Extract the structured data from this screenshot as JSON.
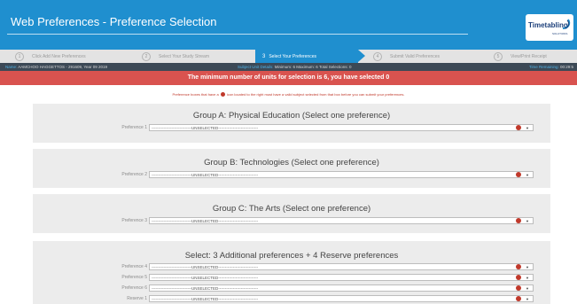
{
  "header": {
    "title": "Web Preferences - Preference Selection",
    "logo_text": "Timetabling",
    "logo_sub": "SOLUTIONS"
  },
  "steps": [
    {
      "num": "1",
      "label": "Click Add New Preferences",
      "active": false
    },
    {
      "num": "2",
      "label": "Select Your Study Stream",
      "active": false
    },
    {
      "num": "3",
      "label": "Select Your Preferences",
      "active": true
    },
    {
      "num": "4",
      "label": "Submit Valid Preferences",
      "active": false
    },
    {
      "num": "5",
      "label": "View/Print Receipt",
      "active": false
    }
  ],
  "infobar": {
    "name_key": "Name:",
    "name_value": "AAMCHOO HAGGETTOS - 291609, Year 09 2019",
    "details_key": "Subject Unit Details:",
    "details_value": "Minimum: 6 Maximum: 6 Total Selections: 0",
    "time_key": "Time Remaining:",
    "time_value": "00:29:5"
  },
  "alert": "The minimum number of units for selection is 6, you have selected 0",
  "note": {
    "before": "Preference boxes that have a",
    "after": "icon located to the right must have a valid subject selected from that box before you can submit your preferences."
  },
  "unselected_text": "------------------------------UNSELECTED------------------------------",
  "groups": [
    {
      "heading": "Group A: Physical Education (Select one preference)",
      "rows": [
        "Preference 1"
      ]
    },
    {
      "heading": "Group B: Technologies (Select one preference)",
      "rows": [
        "Preference 2"
      ]
    },
    {
      "heading": "Group C: The Arts (Select one preference)",
      "rows": [
        "Preference 3"
      ]
    },
    {
      "heading": "Select: 3 Additional preferences + 4 Reserve preferences",
      "rows": [
        "Preference 4",
        "Preference 5",
        "Preference 6",
        "Reserve 1"
      ]
    }
  ],
  "colors": {
    "header_blue": "#1f8fcf",
    "alert_red": "#d9534f",
    "info_dark": "#3c4956",
    "required_red": "#c0392b"
  }
}
